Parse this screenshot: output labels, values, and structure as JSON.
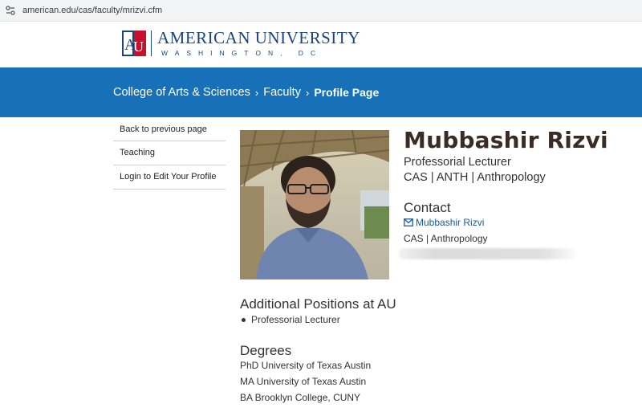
{
  "browser": {
    "url": "american.edu/cas/faculty/mrizvi.cfm"
  },
  "logo": {
    "main": "AMERICAN UNIVERSITY",
    "sub": "WASHINGTON, DC",
    "shield_letters": "AU",
    "colors": {
      "blue": "#1a4480",
      "red": "#c8102e"
    }
  },
  "breadcrumb": {
    "items": [
      "College of Arts & Sciences",
      "Faculty",
      "Profile Page"
    ],
    "separator": "›",
    "band_color": "#1871b8"
  },
  "sidebar": {
    "items": [
      "Back to previous page",
      "Teaching",
      "Login to Edit Your Profile"
    ]
  },
  "profile": {
    "name": "Mubbashir Rizvi",
    "title": "Professorial Lecturer",
    "department_line": "CAS | ANTH | Anthropology",
    "contact_heading": "Contact",
    "email_label": "Mubbashir Rizvi",
    "contact_dept": "CAS | Anthropology"
  },
  "additional_positions": {
    "heading": "Additional Positions at AU",
    "items": [
      "Professorial Lecturer"
    ]
  },
  "degrees": {
    "heading": "Degrees",
    "items": [
      "PhD University of Texas Austin",
      "MA University of Texas Austin",
      "BA Brooklyn College, CUNY"
    ]
  },
  "icons": [
    "site-settings-icon",
    "au-shield-logo-icon",
    "chevron-right-icon",
    "envelope-icon"
  ]
}
